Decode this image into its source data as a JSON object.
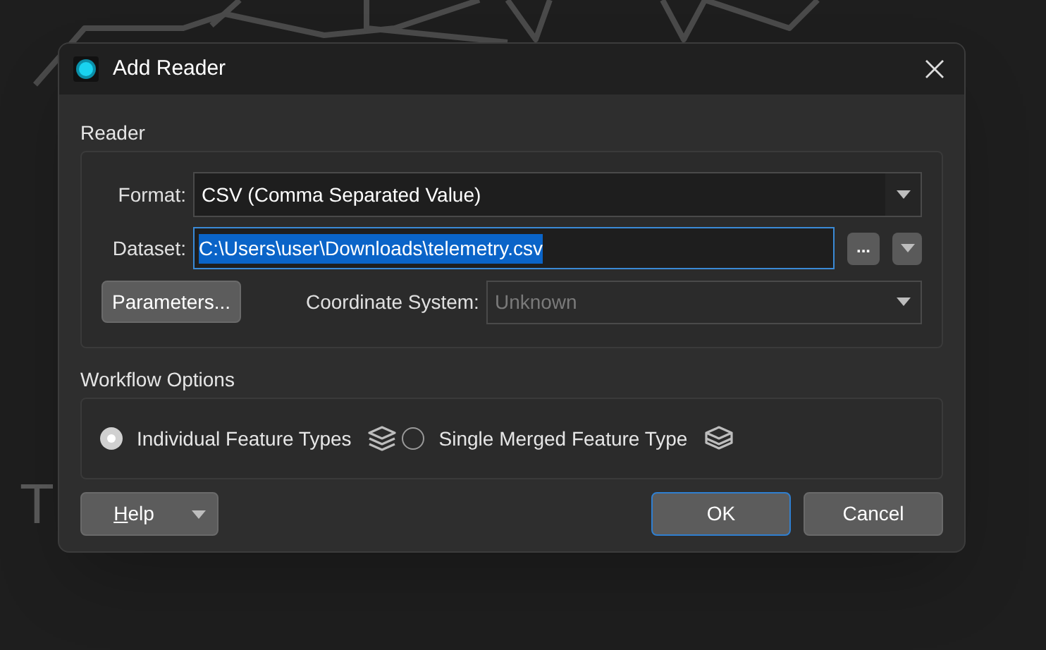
{
  "background": {
    "text": "T"
  },
  "window": {
    "title": "Add Reader"
  },
  "reader": {
    "title": "Reader",
    "format": {
      "label": "Format:",
      "value": "CSV (Comma Separated Value)"
    },
    "dataset": {
      "label": "Dataset:",
      "value": "C:\\Users\\user\\Downloads\\telemetry.csv",
      "selected": true,
      "browse": "..."
    },
    "parameters": "Parameters...",
    "coordinate_system": {
      "label": "Coordinate System:",
      "value": "Unknown",
      "disabled": true
    }
  },
  "workflow": {
    "title": "Workflow Options",
    "options": [
      {
        "label": "Individual Feature Types",
        "selected": true,
        "kind": "individual"
      },
      {
        "label": "Single Merged Feature Type",
        "selected": false,
        "kind": "merged"
      }
    ]
  },
  "buttons": {
    "help": "Help",
    "ok": "OK",
    "cancel": "Cancel"
  }
}
